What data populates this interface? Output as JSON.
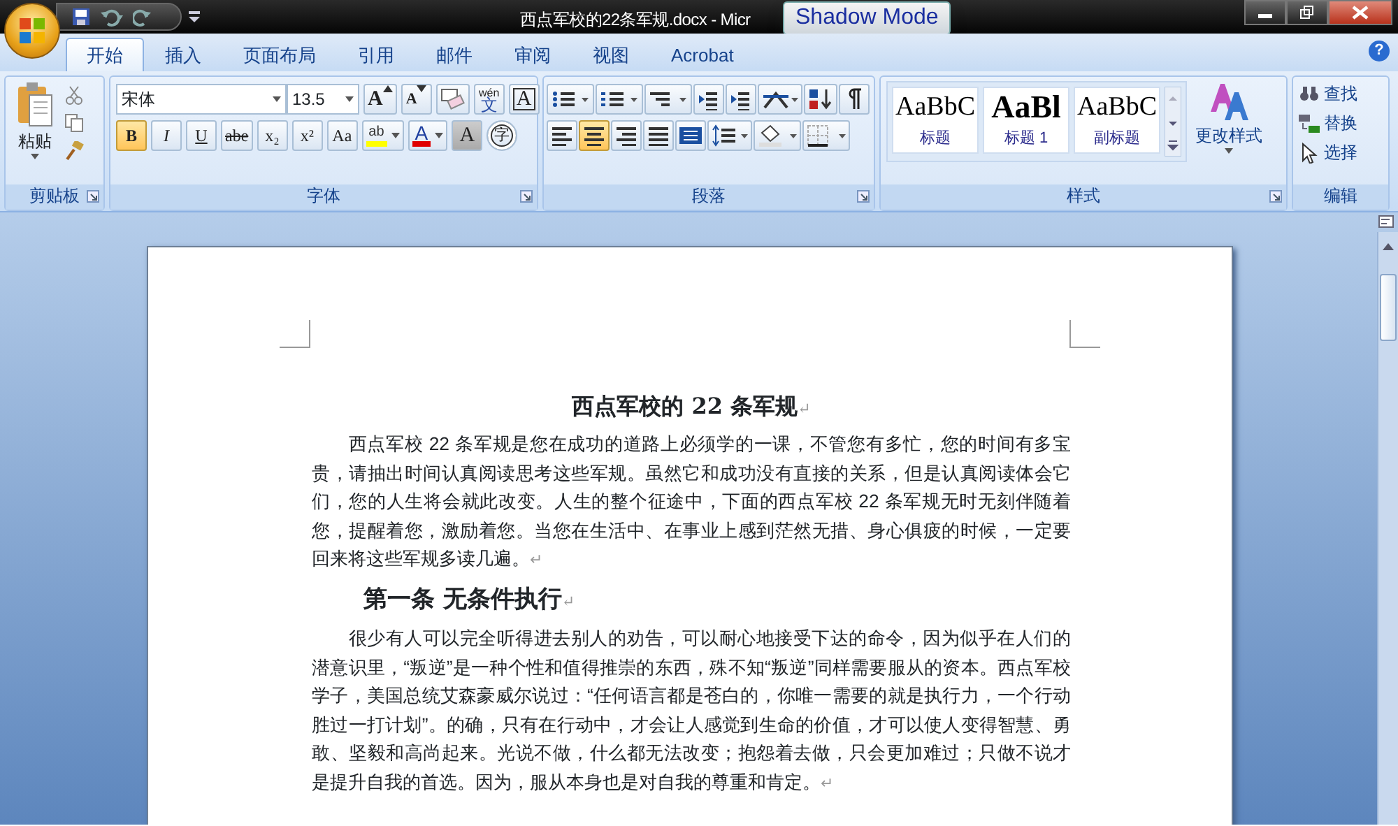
{
  "title_bar": {
    "title": "西点军校的22条军规.docx - Micr",
    "overlay": "Shadow Mode"
  },
  "tabs": [
    {
      "label": "开始",
      "selected": true
    },
    {
      "label": "插入",
      "selected": false
    },
    {
      "label": "页面布局",
      "selected": false
    },
    {
      "label": "引用",
      "selected": false
    },
    {
      "label": "邮件",
      "selected": false
    },
    {
      "label": "审阅",
      "selected": false
    },
    {
      "label": "视图",
      "selected": false
    },
    {
      "label": "Acrobat",
      "selected": false
    }
  ],
  "clipboard": {
    "paste": "粘贴",
    "group": "剪贴板"
  },
  "help": "?",
  "font": {
    "group": "字体",
    "grow_char": "A",
    "shrink_char": "A",
    "highlight_text": "ab",
    "color_char": "A",
    "name": "宋体",
    "size": "13.5",
    "phonetic_top": "wén",
    "phonetic_char": "文",
    "border_char": "A",
    "enclose_char": "字",
    "format_buttons": [
      {
        "label": "B",
        "selected": true
      },
      {
        "label": "I",
        "selected": false
      },
      {
        "label": "U",
        "selected": false
      },
      {
        "label": "abe",
        "selected": false
      },
      {
        "label": "x₂",
        "selected": false
      },
      {
        "label": "x²",
        "selected": false
      },
      {
        "label": "Aa",
        "selected": false
      }
    ],
    "shading_char": "A"
  },
  "paragraph": {
    "group": "段落",
    "align": [
      {
        "selected": false
      },
      {
        "selected": true
      },
      {
        "selected": false
      },
      {
        "selected": false
      }
    ]
  },
  "styles": {
    "group": "样式",
    "change": "更改样式",
    "gallery": [
      {
        "preview": "AaBbC",
        "label": "标题",
        "kind": "normal"
      },
      {
        "preview": "AaBl",
        "label": "标题 1",
        "kind": "large"
      },
      {
        "preview": "AaBbC",
        "label": "副标题",
        "kind": "normal"
      }
    ]
  },
  "editing": {
    "group": "编辑",
    "items": [
      {
        "label": "查找",
        "kind": "find"
      },
      {
        "label": "替换",
        "kind": "replace"
      },
      {
        "label": "选择",
        "kind": "select"
      }
    ]
  },
  "document": {
    "paragraphs": [
      {
        "kind": "title",
        "text": "西点军校的 22 条军规",
        "mark": "↵"
      },
      {
        "kind": "body",
        "text": "西点军校 22 条军规是您在成功的道路上必须学的一课，不管您有多忙，您的时间有多宝贵，请抽出时间认真阅读思考这些军规。虽然它和成功没有直接的关系，但是认真阅读体会它们，您的人生将会就此改变。人生的整个征途中，下面的西点军校 22 条军规无时无刻伴随着您，提醒着您，激励着您。当您在生活中、在事业上感到茫然无措、身心俱疲的时候，一定要回来将这些军规多读几遍。",
        "mark": "↵"
      },
      {
        "kind": "heading",
        "text": "第一条 无条件执行",
        "mark": "↵"
      },
      {
        "kind": "body",
        "text": "很少有人可以完全听得进去别人的劝告，可以耐心地接受下达的命令，因为似乎在人们的潜意识里，“叛逆”是一种个性和值得推崇的东西，殊不知“叛逆”同样需要服从的资本。西点军校学子，美国总统艾森豪威尔说过：“任何语言都是苍白的，你唯一需要的就是执行力，一个行动胜过一打计划”。的确，只有在行动中，才会让人感觉到生命的价值，才可以使人变得智慧、勇敢、坚毅和高尚起来。光说不做，什么都无法改变；抱怨着去做，只会更加难过；只做不说才是提升自我的首选。因为，服从本身也是对自我的尊重和肯定。",
        "mark": "↵"
      }
    ]
  }
}
